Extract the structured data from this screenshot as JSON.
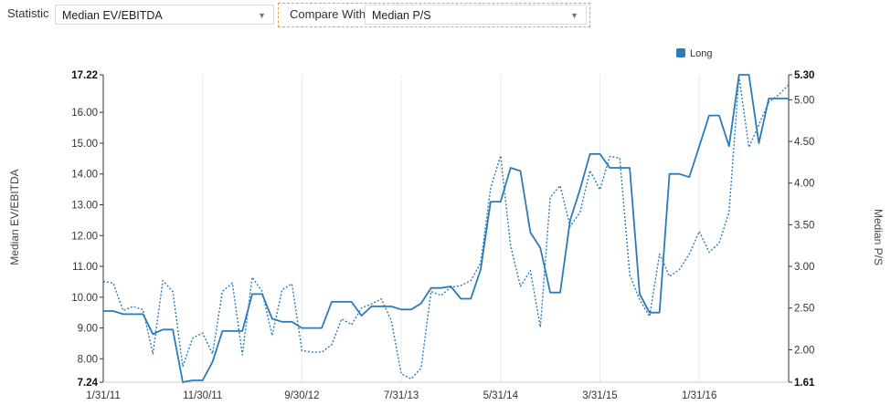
{
  "toolbar": {
    "statistic_label": "Statistic",
    "statistic_value": "Median EV/EBITDA",
    "compare_label": "Compare With",
    "compare_value": "Median P/S"
  },
  "chart_data": {
    "type": "line",
    "xlabel": "",
    "ylabel_left": "Median EV/EBITDA",
    "ylabel_right": "Median P/S",
    "x_tick_labels": [
      "1/31/11",
      "11/30/11",
      "9/30/12",
      "7/31/13",
      "5/31/14",
      "3/31/15",
      "1/31/16"
    ],
    "ylim_left": [
      7.24,
      17.22
    ],
    "ylim_right": [
      1.61,
      5.3
    ],
    "y_ticks_left": [
      "7.24",
      "8.00",
      "9.00",
      "10.00",
      "11.00",
      "12.00",
      "13.00",
      "14.00",
      "15.00",
      "16.00",
      "17.22"
    ],
    "y_ticks_right": [
      "1.61",
      "2.00",
      "2.50",
      "3.00",
      "3.50",
      "4.00",
      "4.50",
      "5.00",
      "5.30"
    ],
    "legend": {
      "placement": "top-right",
      "entries": [
        "Long"
      ]
    },
    "grid": "vertical",
    "colors": {
      "line": "#2b7bb9"
    },
    "months_per_tick": 10,
    "series": [
      {
        "name": "Long",
        "axis": "left",
        "style": "solid",
        "values": [
          9.55,
          9.55,
          9.45,
          9.45,
          9.45,
          8.8,
          8.95,
          8.95,
          7.24,
          7.3,
          7.3,
          7.9,
          8.9,
          8.9,
          8.9,
          10.1,
          10.1,
          9.3,
          9.2,
          9.2,
          9.0,
          9.0,
          9.0,
          9.85,
          9.85,
          9.85,
          9.4,
          9.7,
          9.7,
          9.7,
          9.6,
          9.6,
          9.8,
          10.3,
          10.3,
          10.35,
          9.95,
          9.95,
          10.9,
          13.1,
          13.1,
          14.2,
          14.1,
          12.1,
          11.6,
          10.15,
          10.15,
          12.5,
          13.5,
          14.65,
          14.65,
          14.2,
          14.2,
          14.2,
          10.1,
          9.5,
          9.5,
          14.0,
          14.0,
          13.9,
          14.9,
          15.9,
          15.9,
          14.9,
          17.22,
          17.22,
          15.0,
          16.45,
          16.45,
          16.45
        ]
      },
      {
        "name": "",
        "axis": "right",
        "style": "dotted",
        "values": [
          2.82,
          2.8,
          2.47,
          2.52,
          2.48,
          1.95,
          2.83,
          2.7,
          1.8,
          2.14,
          2.2,
          1.95,
          2.7,
          2.8,
          1.94,
          2.87,
          2.7,
          2.17,
          2.72,
          2.79,
          1.99,
          1.97,
          1.97,
          2.06,
          2.37,
          2.3,
          2.5,
          2.55,
          2.61,
          2.35,
          1.71,
          1.65,
          1.78,
          2.7,
          2.65,
          2.75,
          2.77,
          2.83,
          3.04,
          3.94,
          4.33,
          3.25,
          2.76,
          2.95,
          2.27,
          3.83,
          3.97,
          3.48,
          3.65,
          4.15,
          3.92,
          4.32,
          4.3,
          2.9,
          2.6,
          2.4,
          3.15,
          2.88,
          2.96,
          3.15,
          3.42,
          3.17,
          3.28,
          3.65,
          5.28,
          4.43,
          4.7,
          4.97,
          5.06,
          5.18
        ]
      }
    ]
  }
}
